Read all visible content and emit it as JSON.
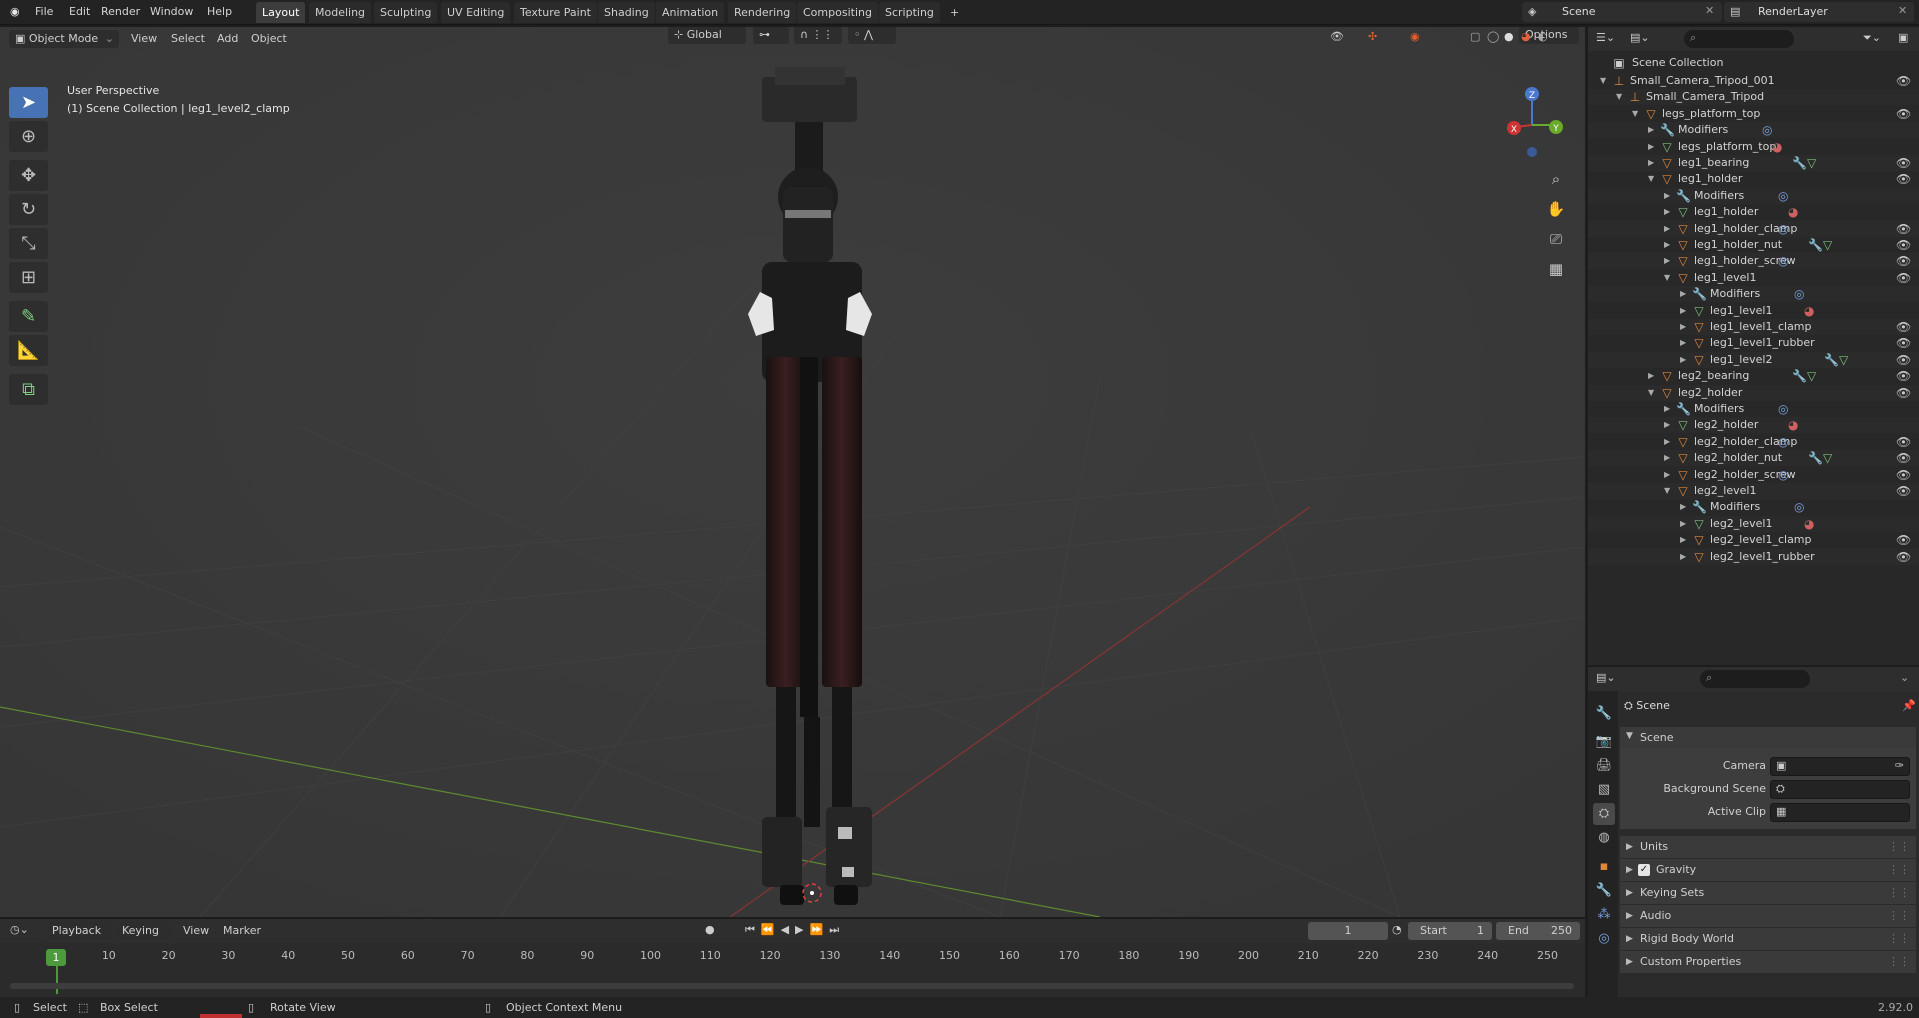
{
  "menu": {
    "file": "File",
    "edit": "Edit",
    "render": "Render",
    "window": "Window",
    "help": "Help"
  },
  "workspaces": [
    "Layout",
    "Modeling",
    "Sculpting",
    "UV Editing",
    "Texture Paint",
    "Shading",
    "Animation",
    "Rendering",
    "Compositing",
    "Scripting"
  ],
  "top_right": {
    "scene": "Scene",
    "view_layer": "RenderLayer"
  },
  "viewport": {
    "mode": "Object Mode",
    "view": "View",
    "select": "Select",
    "add": "Add",
    "object": "Object",
    "transform": "Global",
    "options": "Options",
    "perspective": "User Perspective",
    "context": "(1) Scene Collection | leg1_level2_clamp",
    "gizmo": {
      "x": "X",
      "y": "Y",
      "z": "Z"
    }
  },
  "outliner": {
    "root": "Scene Collection",
    "rows": [
      {
        "label": "Small_Camera_Tripod_001",
        "icon": "empty-icon",
        "eye": true
      },
      {
        "label": "Small_Camera_Tripod",
        "icon": "empty-icon",
        "eye": false
      },
      {
        "label": "legs_platform_top",
        "icon": "mesh-object-icon",
        "eye": true
      },
      {
        "label": "Modifiers",
        "icon": "wrench-icon",
        "eye": false
      },
      {
        "label": "legs_platform_top",
        "icon": "mesh-data-icon",
        "eye": false
      },
      {
        "label": "leg1_bearing",
        "icon": "mesh-object-icon",
        "eye": true
      },
      {
        "label": "leg1_holder",
        "icon": "mesh-object-icon",
        "eye": true
      },
      {
        "label": "Modifiers",
        "icon": "wrench-icon",
        "eye": false
      },
      {
        "label": "leg1_holder",
        "icon": "mesh-data-icon",
        "eye": false
      },
      {
        "label": "leg1_holder_clamp",
        "icon": "mesh-object-icon",
        "eye": true
      },
      {
        "label": "leg1_holder_nut",
        "icon": "mesh-object-icon",
        "eye": true
      },
      {
        "label": "leg1_holder_screw",
        "icon": "mesh-object-icon",
        "eye": true
      },
      {
        "label": "leg1_level1",
        "icon": "mesh-object-icon",
        "eye": true
      },
      {
        "label": "Modifiers",
        "icon": "wrench-icon",
        "eye": false
      },
      {
        "label": "leg1_level1",
        "icon": "mesh-data-icon",
        "eye": false
      },
      {
        "label": "leg1_level1_clamp",
        "icon": "mesh-object-icon",
        "eye": true
      },
      {
        "label": "leg1_level1_rubber",
        "icon": "mesh-object-icon",
        "eye": true
      },
      {
        "label": "leg1_level2",
        "icon": "mesh-object-icon",
        "eye": true
      },
      {
        "label": "leg2_bearing",
        "icon": "mesh-object-icon",
        "eye": true
      },
      {
        "label": "leg2_holder",
        "icon": "mesh-object-icon",
        "eye": true
      },
      {
        "label": "Modifiers",
        "icon": "wrench-icon",
        "eye": false
      },
      {
        "label": "leg2_holder",
        "icon": "mesh-data-icon",
        "eye": false
      },
      {
        "label": "leg2_holder_clamp",
        "icon": "mesh-object-icon",
        "eye": true
      },
      {
        "label": "leg2_holder_nut",
        "icon": "mesh-object-icon",
        "eye": true
      },
      {
        "label": "leg2_holder_screw",
        "icon": "mesh-object-icon",
        "eye": true
      },
      {
        "label": "leg2_level1",
        "icon": "mesh-object-icon",
        "eye": true
      },
      {
        "label": "Modifiers",
        "icon": "wrench-icon",
        "eye": false
      },
      {
        "label": "leg2_level1",
        "icon": "mesh-data-icon",
        "eye": false
      },
      {
        "label": "leg2_level1_clamp",
        "icon": "mesh-object-icon",
        "eye": true
      },
      {
        "label": "leg2_level1_rubber",
        "icon": "mesh-object-icon",
        "eye": true
      }
    ]
  },
  "properties": {
    "header": "Scene",
    "panel": "Scene",
    "camera_label": "Camera",
    "background_scene_label": "Background Scene",
    "active_clip_label": "Active Clip",
    "sections": [
      "Units",
      "Gravity",
      "Keying Sets",
      "Audio",
      "Rigid Body World",
      "Custom Properties"
    ]
  },
  "timeline": {
    "playback": "Playback",
    "keying": "Keying",
    "view": "View",
    "marker": "Marker",
    "current_frame": "1",
    "start_label": "Start",
    "start": "1",
    "end_label": "End",
    "end": "250",
    "ticks": [
      "1",
      "10",
      "20",
      "30",
      "40",
      "50",
      "60",
      "70",
      "80",
      "90",
      "100",
      "110",
      "120",
      "130",
      "140",
      "150",
      "160",
      "170",
      "180",
      "190",
      "200",
      "210",
      "220",
      "230",
      "240",
      "250"
    ]
  },
  "status": {
    "select": "Select",
    "box_select": "Box Select",
    "rotate_view": "Rotate View",
    "context_menu": "Object Context Menu",
    "version": "2.92.0"
  },
  "colors": {
    "accent": "#4772b3",
    "object_orange": "#e0873a",
    "mesh_green": "#7ac27a",
    "modifier_blue": "#7aa0e0"
  }
}
